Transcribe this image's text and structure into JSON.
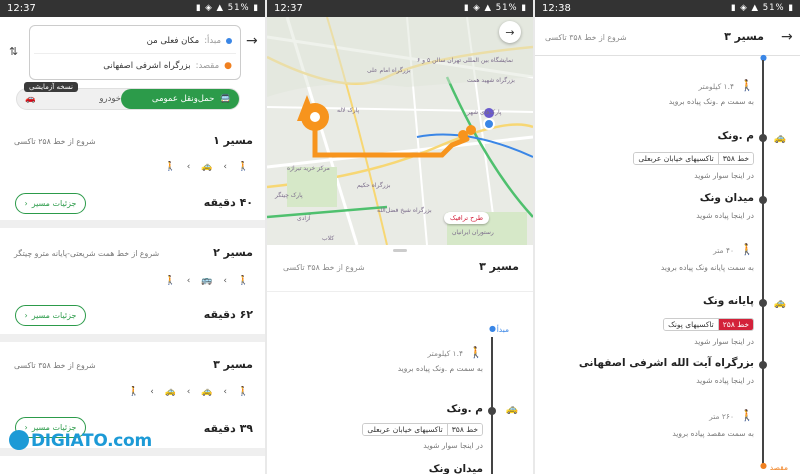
{
  "colors": {
    "accent_green": "#2c9b4a",
    "route_orange": "#f7941d",
    "line_red": "#d3213a",
    "link_blue": "#3a86e6"
  },
  "panel1": {
    "status": {
      "time": "12:37",
      "battery": "51%"
    },
    "origin_label": "مبدأ:",
    "origin_value": "مکان فعلی من",
    "destination_label": "مقصد:",
    "destination_value": "بزرگراه اشرفی اصفهانی",
    "beta_badge": "نسخه آزمایشی",
    "mode_transit": "حمل‌ونقل عمومی",
    "mode_car": "خودرو",
    "details_label": "جزئیات مسیر",
    "routes": [
      {
        "title": "مسیر ۱",
        "subtitle": "شروع از خط ۲۵۸ تاکسی",
        "time": "۴۰ دقیقه",
        "steps": "🚶 ‹ 🚕 ‹ 🚶"
      },
      {
        "title": "مسیر ۲",
        "subtitle": "شروع از خط همت شریعتی-پایانه مترو چیتگر",
        "time": "۶۲ دقیقه",
        "steps": "🚶 ‹ 🚌 ‹ 🚶"
      },
      {
        "title": "مسیر ۳",
        "subtitle": "شروع از خط ۳۵۸ تاکسی",
        "time": "۳۹ دقیقه",
        "steps": "🚶 ‹ 🚕 ‹ 🚕 ‹ 🚶"
      }
    ],
    "logo": "DIGIATO.com"
  },
  "panel2": {
    "status": {
      "time": "12:37",
      "battery": "51%"
    },
    "map_labels": [
      "نمایشگاه بین المللی تهران سالن ۵ و ۶",
      "بزرگراه امام علی",
      "پارک لاله",
      "بزرگراه شهید همت",
      "مرکز خرید تیراژه",
      "بزرگراه حکیم",
      "پارک‌های شهر",
      "پارک چیتگر",
      "کلاب",
      "آزادی",
      "طرح ترافیک",
      "رستوران ایرانیان",
      "بزرگراه شیخ فضل‌الله"
    ],
    "traffic_label": "طرح ترافیک",
    "header_title": "مسیر ۳",
    "header_sub": "شروع از خط ۳۵۸ تاکسی",
    "start": "مبدأ",
    "walk1_dist": "۱.۴ کیلومتر",
    "walk1_text": "به سمت م .ونک پیاده بروید",
    "stop1": "م .ونک",
    "line1": "خط ۳۵۸",
    "line1_name": "تاکسیهای خیابان عربعلی",
    "board_text": "در اینجا سوار شوید",
    "stop2": "میدان ونک"
  },
  "panel3": {
    "status": {
      "time": "12:38",
      "battery": "51%"
    },
    "header_title": "مسیر ۳",
    "header_sub": "شروع از خط ۳۵۸ تاکسی",
    "walk1_dist": "۱.۴ کیلومتر",
    "walk1_text": "به سمت م .ونک پیاده بروید",
    "stop1": "م .ونک",
    "line1": "خط ۳۵۸",
    "line1_name": "تاکسیهای خیابان عربعلی",
    "board_text": "در اینجا سوار شوید",
    "stop2": "میدان ونک",
    "alight_text": "در اینجا پیاده شوید",
    "walk2_dist": "۴۰ متر",
    "walk2_text": "به سمت پایانه ونک پیاده بروید",
    "stop3": "پایانه ونک",
    "line2": "خط ۲۵۸",
    "line2_name": "تاکسیهای پونک",
    "board_text2": "در اینجا سوار شوید",
    "stop4": "بزرگراه آیت الله اشرفی اصفهانی",
    "alight_text2": "در اینجا پیاده شوید",
    "walk3_dist": "۲۶۰ متر",
    "walk3_text": "به سمت مقصد پیاده بروید",
    "end": "مقصد"
  }
}
